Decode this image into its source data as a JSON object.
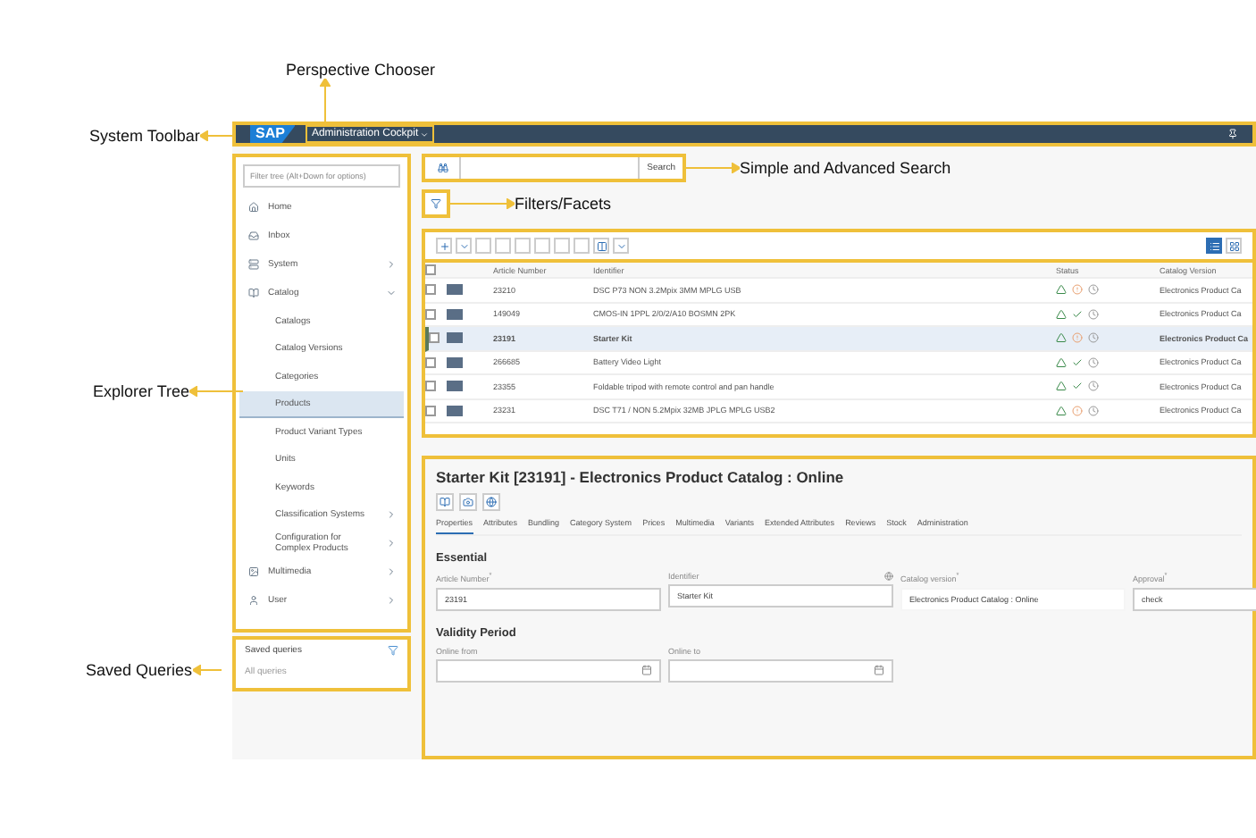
{
  "callouts": {
    "perspective": "Perspective Chooser",
    "toolbar": "System Toolbar",
    "search": "Simple and Advanced Search",
    "filters": "Filters/Facets",
    "explorer": "Explorer Tree",
    "queries": "Saved Queries"
  },
  "system_toolbar": {
    "logo": "SAP",
    "perspective": "Administration Cockpit"
  },
  "explorer": {
    "filter_placeholder": "Filter tree (Alt+Down for options)",
    "items": [
      {
        "label": "Home",
        "selected": false
      },
      {
        "label": "Inbox",
        "selected": false
      },
      {
        "label": "System",
        "expanded": false,
        "selected": false
      },
      {
        "label": "Catalog",
        "expanded": true,
        "selected": false,
        "children": [
          {
            "label": "Catalogs",
            "selected": false
          },
          {
            "label": "Catalog Versions",
            "selected": false
          },
          {
            "label": "Categories",
            "selected": false
          },
          {
            "label": "Products",
            "selected": true
          },
          {
            "label": "Product Variant Types",
            "selected": false
          },
          {
            "label": "Units",
            "selected": false
          },
          {
            "label": "Keywords",
            "selected": false
          },
          {
            "label": "Classification Systems",
            "selected": false,
            "expanded": false
          },
          {
            "label": "Configuration for Complex Products",
            "selected": false,
            "expanded": false
          }
        ]
      },
      {
        "label": "Multimedia",
        "expanded": false,
        "selected": false
      },
      {
        "label": "User",
        "expanded": false,
        "selected": false
      }
    ]
  },
  "saved_queries": {
    "title": "Saved queries",
    "items": [
      "All queries"
    ]
  },
  "search": {
    "button": "Search"
  },
  "table": {
    "select_all_checked": false,
    "columns": [
      "Article Number",
      "Identifier",
      "Status",
      "Catalog Version"
    ],
    "rows": [
      {
        "article": "23210",
        "identifier": "DSC P73 NON 3.2Mpix 3MM MPLG USB",
        "kind": "warning",
        "catalog": "Electronics Product Ca",
        "selected": false,
        "checked": false
      },
      {
        "article": "149049",
        "identifier": "CMOS-IN 1PPL 2/0/2/A10 BOSMN 2PK",
        "kind": "ok",
        "catalog": "Electronics Product Ca",
        "selected": false,
        "checked": false
      },
      {
        "article": "23191",
        "identifier": "Starter Kit",
        "kind": "warning",
        "catalog": "Electronics Product Ca",
        "selected": true,
        "checked": false
      },
      {
        "article": "266685",
        "identifier": "Battery Video Light",
        "kind": "ok",
        "catalog": "Electronics Product Ca",
        "selected": false,
        "checked": false
      },
      {
        "article": "23355",
        "identifier": "Foldable tripod with remote control and pan handle",
        "kind": "ok",
        "catalog": "Electronics Product Ca",
        "selected": false,
        "checked": false
      },
      {
        "article": "23231",
        "identifier": "DSC T71 / NON 5.2Mpix 32MB JPLG MPLG USB2",
        "kind": "warning",
        "catalog": "Electronics Product Ca",
        "selected": false,
        "checked": false
      }
    ]
  },
  "detail": {
    "title": "Starter Kit [23191] - Electronics Product Catalog : Online",
    "tabs": [
      {
        "label": "Properties",
        "selected": true
      },
      {
        "label": "Attributes",
        "selected": false
      },
      {
        "label": "Bundling",
        "selected": false
      },
      {
        "label": "Category System",
        "selected": false
      },
      {
        "label": "Prices",
        "selected": false
      },
      {
        "label": "Multimedia",
        "selected": false
      },
      {
        "label": "Variants",
        "selected": false
      },
      {
        "label": "Extended Attributes",
        "selected": false
      },
      {
        "label": "Reviews",
        "selected": false
      },
      {
        "label": "Stock",
        "selected": false
      },
      {
        "label": "Administration",
        "selected": false
      }
    ],
    "sections": [
      {
        "title": "Essential",
        "fields": [
          {
            "label": "Article Number$^{*}$",
            "value": "23191",
            "kind": "text"
          },
          {
            "label": "Identifier",
            "value": "Starter Kit",
            "kind": "localized"
          },
          {
            "label": "Catalog version$^{*}$",
            "value": "Electronics Product Catalog : Online",
            "kind": "readonly"
          },
          {
            "label": "Approval$^{*}$",
            "value": "check",
            "kind": "text"
          }
        ]
      },
      {
        "title": "Validity Period",
        "fields": [
          {
            "label": "Online from",
            "kind": "date"
          },
          {
            "label": "Online to",
            "kind": "date"
          }
        ]
      }
    ]
  }
}
